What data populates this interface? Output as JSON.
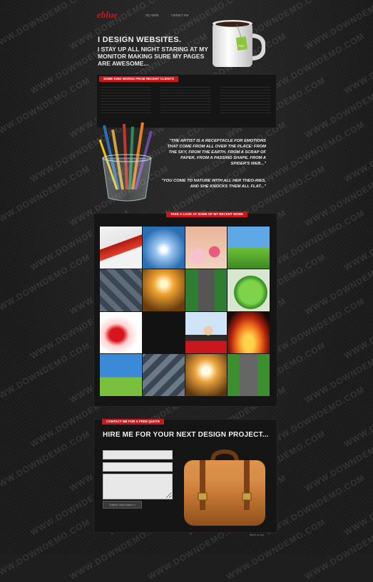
{
  "header": {
    "logo": "eblue",
    "nav": [
      "my work",
      "contact me"
    ]
  },
  "hero": {
    "title": "I DESIGN WEBSITES.",
    "subtitle": "I STAY UP ALL NIGHT STARING AT MY MONITOR MAKING SURE MY PAGES ARE AWESOME...",
    "mug_tag": "PSD"
  },
  "words": {
    "heading": "SOME KIND WORDS FROM RECENT CLIENTS"
  },
  "quotes": [
    "\"THE ARTIST IS A RECEPTACLE FOR EMOTIONS THAT COME FROM ALL OVER THE PLACE: FROM THE SKY, FROM THE EARTH, FROM A SCRAP OF PAPER, FROM A PASSING SHAPE, FROM A SPIDER'S WEB...\"",
    "\"YOU COME TO NATURE WITH ALL HER THEO-RIES, AND SHE KNOCKS THEM ALL FLAT...\""
  ],
  "portfolio": {
    "heading": "TAKE A LOOK AT SOME OF MY RECENT WORK",
    "tiles": [
      "red-leaves-tile",
      "sky-sun-tile",
      "flowers-feet-tile",
      "green-field-tile",
      "puzzle-tile",
      "sunset-cyclist-tile",
      "road-trees-tile",
      "green-leaf-tile",
      "red-smoke-tile",
      "dark-tile",
      "woman-hair-tile",
      "fire-tile",
      "field-sky-tile",
      "puzzle-tile-2",
      "sunset-cyclist-tile-2",
      "road-trees-tile-2"
    ]
  },
  "contact": {
    "tag": "CONTACT ME FOR A FREE QUOTE",
    "title": "HIRE ME FOR YOUR NEXT DESIGN PROJECT...",
    "submit_label": "Submit Information »"
  },
  "footer": {
    "text": "Back to top"
  },
  "watermark": "WWW.DOWNDEMO.COM",
  "colors": {
    "accent": "#c8181e",
    "background": "#1e1e1e",
    "panel": "#151515"
  }
}
